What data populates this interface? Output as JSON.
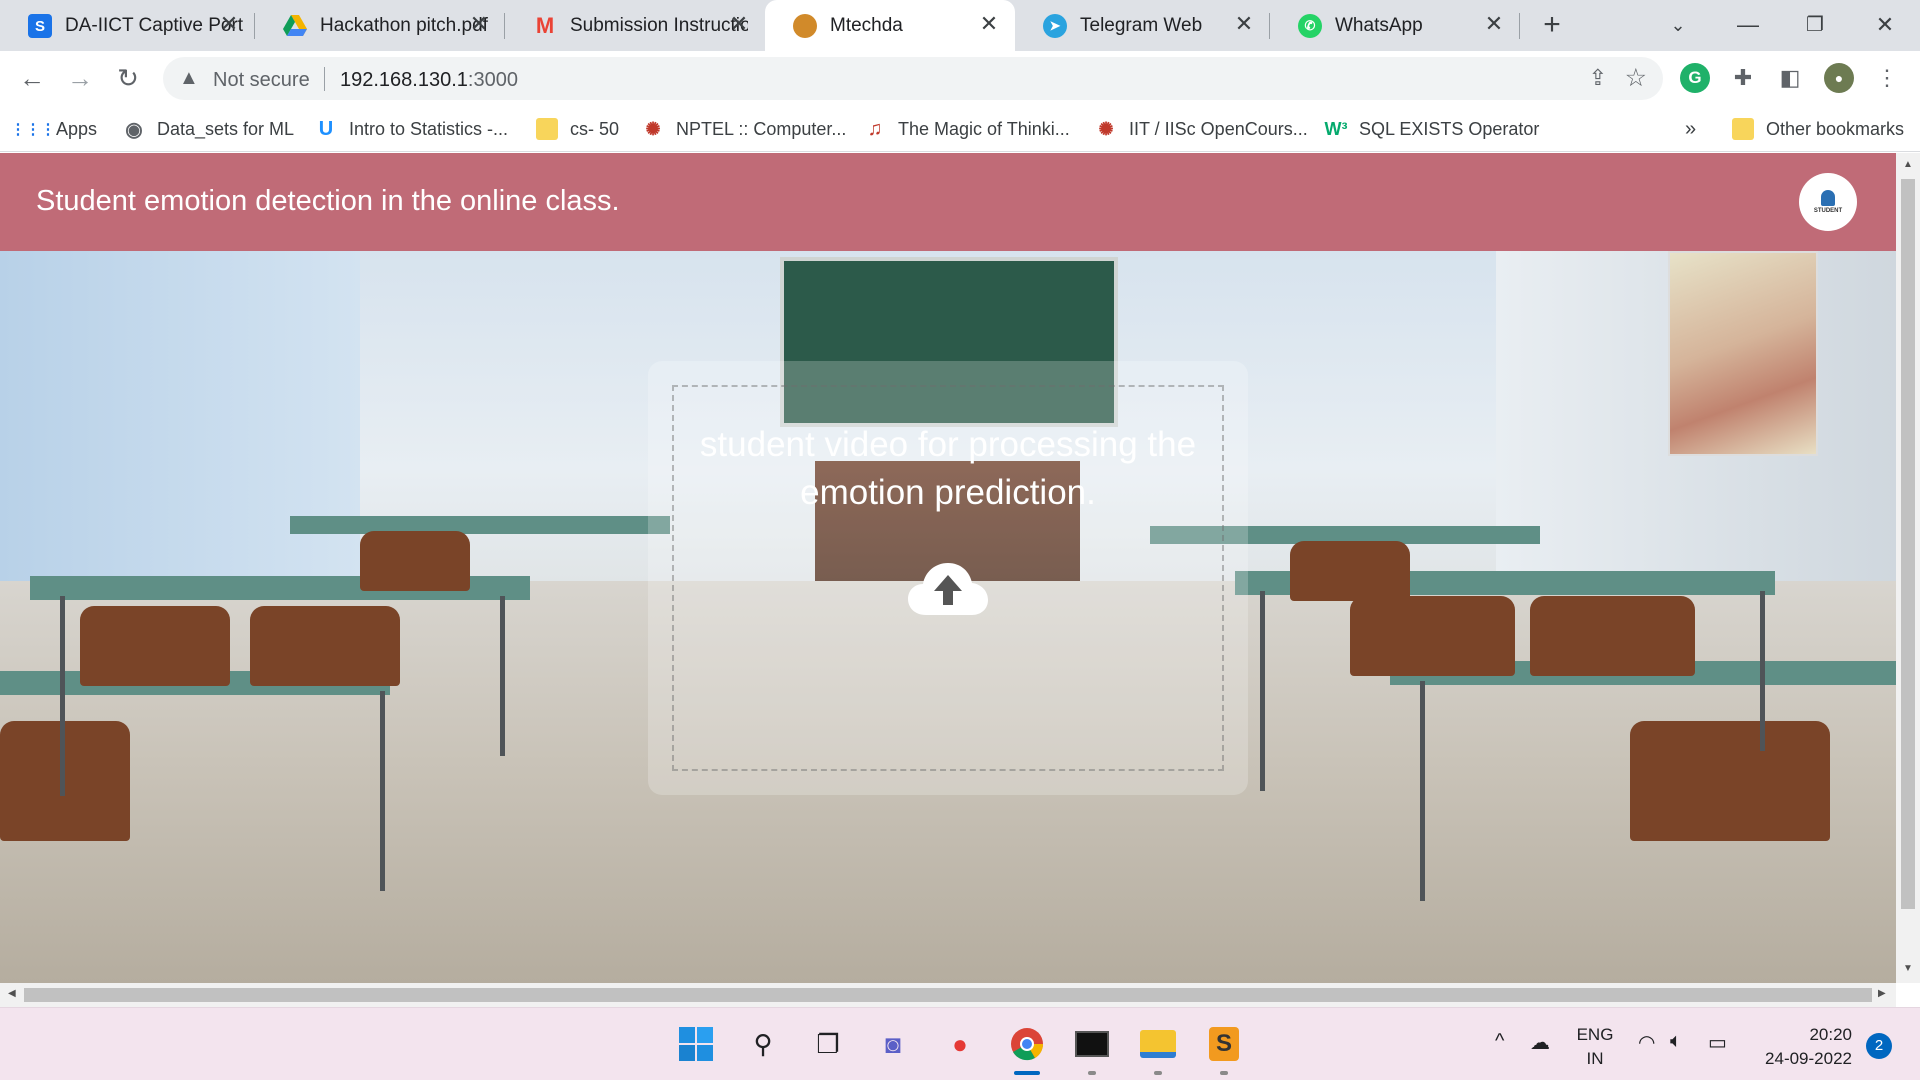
{
  "browser": {
    "tabs": [
      {
        "title": "DA-IICT Captive Portal",
        "icon": "s-logo-icon",
        "color": "#1a73e8"
      },
      {
        "title": "Hackathon pitch.pdf",
        "icon": "google-drive-icon",
        "color": "#f4b400"
      },
      {
        "title": "Submission Instructions",
        "icon": "gmail-icon",
        "color": "#ea4335"
      },
      {
        "title": "Mtechda",
        "icon": "site-icon",
        "color": "#d18a2a",
        "active": true
      },
      {
        "title": "Telegram Web",
        "icon": "telegram-icon",
        "color": "#2aa3df"
      },
      {
        "title": "WhatsApp",
        "icon": "whatsapp-icon",
        "color": "#25d366"
      }
    ],
    "address": {
      "security": "Not secure",
      "url_host": "192.168.130.1",
      "url_port": ":3000"
    },
    "bookmarks": [
      {
        "label": "Apps",
        "icon": "apps-grid-icon"
      },
      {
        "label": "Data_sets for ML",
        "icon": "globe-icon"
      },
      {
        "label": "Intro to Statistics -...",
        "icon": "udacity-icon"
      },
      {
        "label": "cs- 50",
        "icon": "folder-icon"
      },
      {
        "label": "NPTEL :: Computer...",
        "icon": "nptel-icon"
      },
      {
        "label": "The Magic of Thinki...",
        "icon": "headphones-icon"
      },
      {
        "label": "IIT / IISc OpenCours...",
        "icon": "nptel-icon"
      },
      {
        "label": "SQL EXISTS Operator",
        "icon": "w3schools-icon"
      }
    ],
    "bookmarks_overflow": "»",
    "other_bookmarks": "Other bookmarks"
  },
  "app": {
    "title": "Student emotion detection in the online class.",
    "logo_text": "STUDENT",
    "upload_text": "student video for processing the emotion prediction.",
    "accent": "#c06b77"
  },
  "taskbar": {
    "apps": [
      "windows-start-icon",
      "search-icon",
      "task-view-icon",
      "teams-chat-icon",
      "tomato-app-icon",
      "chrome-icon",
      "terminal-icon",
      "file-explorer-icon",
      "sublime-text-icon"
    ],
    "lang_1": "ENG",
    "lang_2": "IN",
    "time": "20:20",
    "date": "24-09-2022",
    "notifications": "2"
  }
}
